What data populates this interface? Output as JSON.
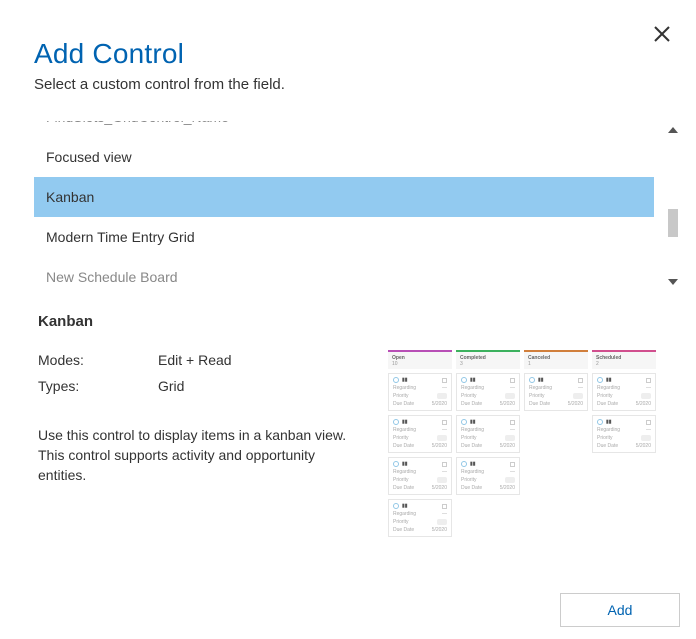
{
  "header": {
    "title": "Add Control",
    "subtitle": "Select a custom control from the field."
  },
  "list": {
    "items": [
      {
        "label": "FindSlots_GridControl_Name",
        "truncated": "top"
      },
      {
        "label": "Focused view"
      },
      {
        "label": "Kanban",
        "selected": true
      },
      {
        "label": "Modern Time Entry Grid"
      },
      {
        "label": "New Schedule Board",
        "truncated": "bottom"
      }
    ]
  },
  "details": {
    "title": "Kanban",
    "modes_label": "Modes:",
    "modes_value": "Edit + Read",
    "types_label": "Types:",
    "types_value": "Grid",
    "description": "Use this control to display items in a kanban view. This control supports activity and opportunity entities."
  },
  "preview": {
    "columns": [
      {
        "name": "Open",
        "count": "10",
        "cls": "open",
        "cards": 4
      },
      {
        "name": "Completed",
        "count": "3",
        "cls": "done",
        "cards": 3
      },
      {
        "name": "Canceled",
        "count": "1",
        "cls": "cancel",
        "cards": 1
      },
      {
        "name": "Scheduled",
        "count": "2",
        "cls": "sched",
        "cards": 2
      }
    ]
  },
  "footer": {
    "add_label": "Add"
  }
}
